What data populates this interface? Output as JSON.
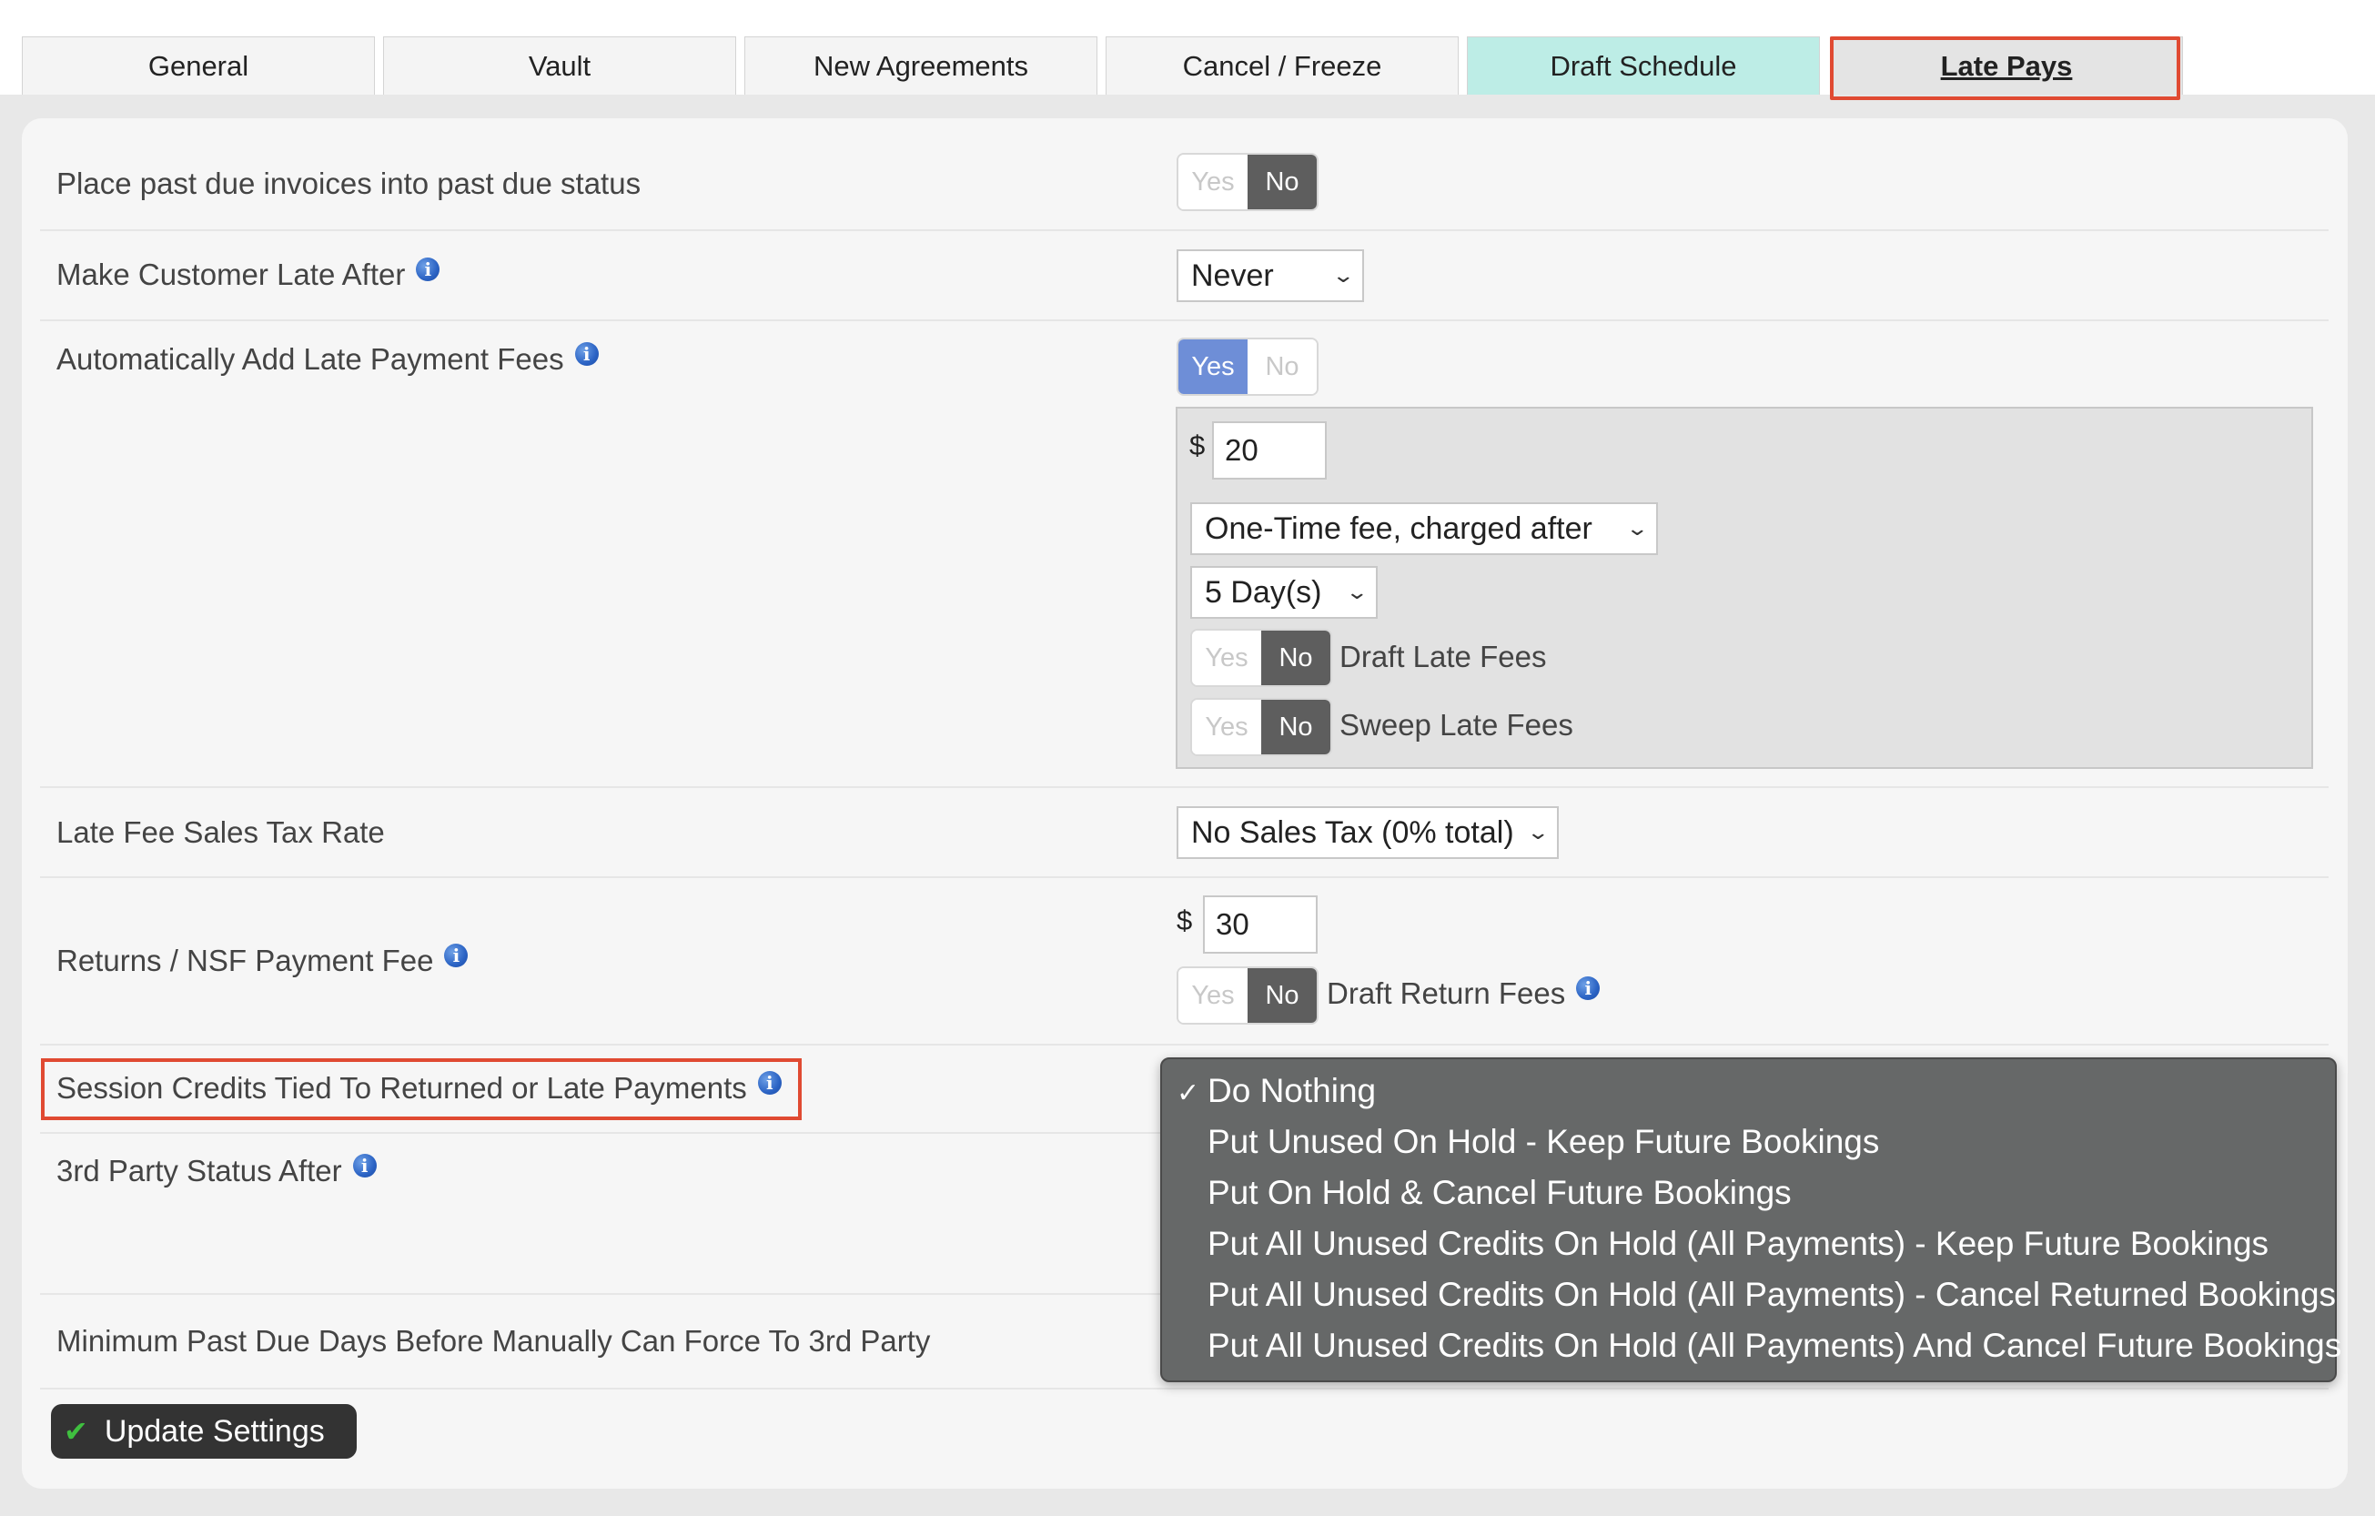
{
  "tabs": [
    {
      "label": "General"
    },
    {
      "label": "Vault"
    },
    {
      "label": "New Agreements"
    },
    {
      "label": "Cancel / Freeze"
    },
    {
      "label": "Draft Schedule"
    },
    {
      "label": "Late Pays"
    }
  ],
  "active_tab": "Late Pays",
  "settings": {
    "past_due_status": {
      "label": "Place past due invoices into past due status",
      "yes": "Yes",
      "no": "No",
      "value": "No"
    },
    "make_late_after": {
      "label": "Make Customer Late After",
      "value": "Never"
    },
    "auto_late_fees": {
      "label": "Automatically Add Late Payment Fees",
      "yes": "Yes",
      "no": "No",
      "value": "Yes",
      "currency": "$",
      "amount": "20",
      "fee_type": "One-Time fee, charged after",
      "days": "5 Day(s)",
      "draft_late_fees": {
        "label": "Draft Late Fees",
        "yes": "Yes",
        "no": "No",
        "value": "No"
      },
      "sweep_late_fees": {
        "label": "Sweep Late Fees",
        "yes": "Yes",
        "no": "No",
        "value": "No"
      }
    },
    "late_fee_tax": {
      "label": "Late Fee Sales Tax Rate",
      "value": "No Sales Tax (0% total)"
    },
    "nsf_fee": {
      "label": "Returns / NSF Payment Fee",
      "currency": "$",
      "amount": "30",
      "draft_return_fees": {
        "label": "Draft Return Fees",
        "yes": "Yes",
        "no": "No",
        "value": "No"
      }
    },
    "session_credits": {
      "label": "Session Credits Tied To Returned or Late Payments"
    },
    "third_party": {
      "label": "3rd Party Status After"
    },
    "min_past_due": {
      "label": "Minimum Past Due Days Before Manually Can Force To 3rd Party"
    }
  },
  "dropdown": {
    "check": "✓",
    "selected": "Do Nothing",
    "options": [
      "Do Nothing",
      "Put Unused On Hold - Keep Future Bookings",
      "Put On Hold & Cancel Future Bookings",
      "Put All Unused Credits On Hold (All Payments) - Keep Future Bookings",
      "Put All Unused Credits On Hold (All Payments) - Cancel Returned Bookings",
      "Put All Unused Credits On Hold (All Payments) And Cancel Future Bookings"
    ]
  },
  "update_button": {
    "label": "Update Settings",
    "icon": "check-icon"
  },
  "colors": {
    "highlight": "#e04a32",
    "teal_tab": "#bdede6",
    "yes_active": "#6e8ed7",
    "no_active": "#5e5e5e",
    "dropdown_bg": "#666868"
  }
}
